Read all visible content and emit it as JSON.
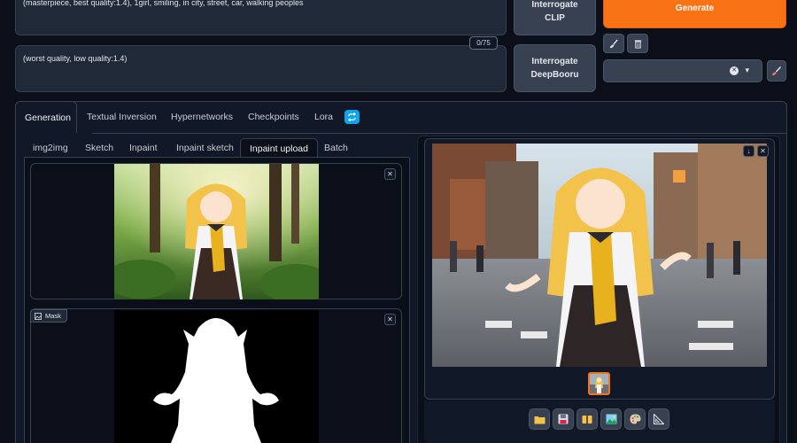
{
  "prompts": {
    "positive": "(masterpiece, best quality:1.4), 1girl, smiling, in city, street, car, walking peoples",
    "negative": "(worst quality, low quality:1.4)",
    "token_count": "0/75"
  },
  "buttons": {
    "interrogate_clip": "Interrogate CLIP",
    "interrogate_deepbooru": "Interrogate DeepBooru",
    "generate": "Generate"
  },
  "tabs": [
    "Generation",
    "Textual Inversion",
    "Hypernetworks",
    "Checkpoints",
    "Lora"
  ],
  "subtabs": [
    "img2img",
    "Sketch",
    "Inpaint",
    "Inpaint sketch",
    "Inpaint upload",
    "Batch"
  ],
  "mask_label": "Mask",
  "icons": {
    "style_clear": "close-icon",
    "style_dropdown": "chevron-down-icon",
    "brush": "paint-brush-icon",
    "trash": "trash-icon",
    "refresh": "refresh-icon",
    "folder": "folder-icon",
    "save": "save-icon",
    "zip": "zip-icon",
    "image": "image-icon",
    "palette": "palette-icon",
    "ruler": "ruler-icon"
  },
  "colors": {
    "accent": "#f97316",
    "refresh": "#0ea5e9",
    "background": "#0b0f19",
    "panel": "#1f2937"
  }
}
